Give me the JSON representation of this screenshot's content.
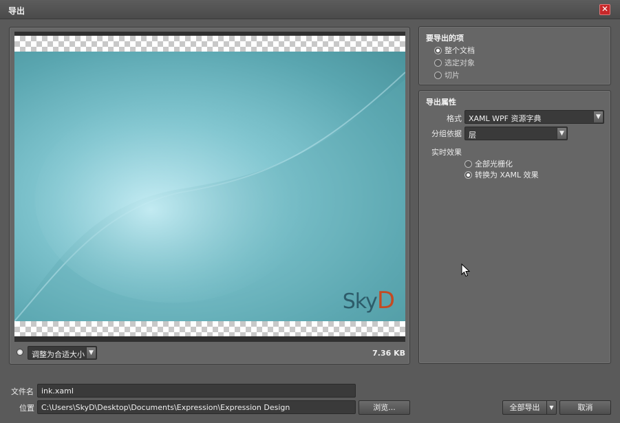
{
  "window": {
    "title": "导出",
    "close_glyph": "✕"
  },
  "preview": {
    "logo_sky": "Sky",
    "logo_d": "D",
    "zoom_select_value": "调整为合适大小",
    "file_size": "7.36 KB"
  },
  "export_items": {
    "title": "要导出的项",
    "options": [
      {
        "label": "整个文档",
        "checked": true
      },
      {
        "label": "选定对象",
        "checked": false
      },
      {
        "label": "切片",
        "checked": false
      }
    ]
  },
  "export_props": {
    "title": "导出属性",
    "format_label": "格式",
    "format_value": "XAML WPF 资源字典",
    "group_label": "分组依据",
    "group_value": "层",
    "live_effects_label": "实时效果",
    "effect_options": [
      {
        "label": "全部光栅化",
        "checked": false
      },
      {
        "label": "转换为 XAML 效果",
        "checked": true
      }
    ]
  },
  "bottom": {
    "filename_label": "文件名",
    "filename_value": "ink.xaml",
    "location_label": "位置",
    "location_value": "C:\\Users\\SkyD\\Desktop\\Documents\\Expression\\Expression Design",
    "browse_label": "浏览...",
    "export_all_label": "全部导出",
    "cancel_label": "取消"
  },
  "colors": {
    "accent_close": "#c8282a",
    "logo_blue": "#2d5c6a",
    "logo_orange": "#c44a22"
  }
}
